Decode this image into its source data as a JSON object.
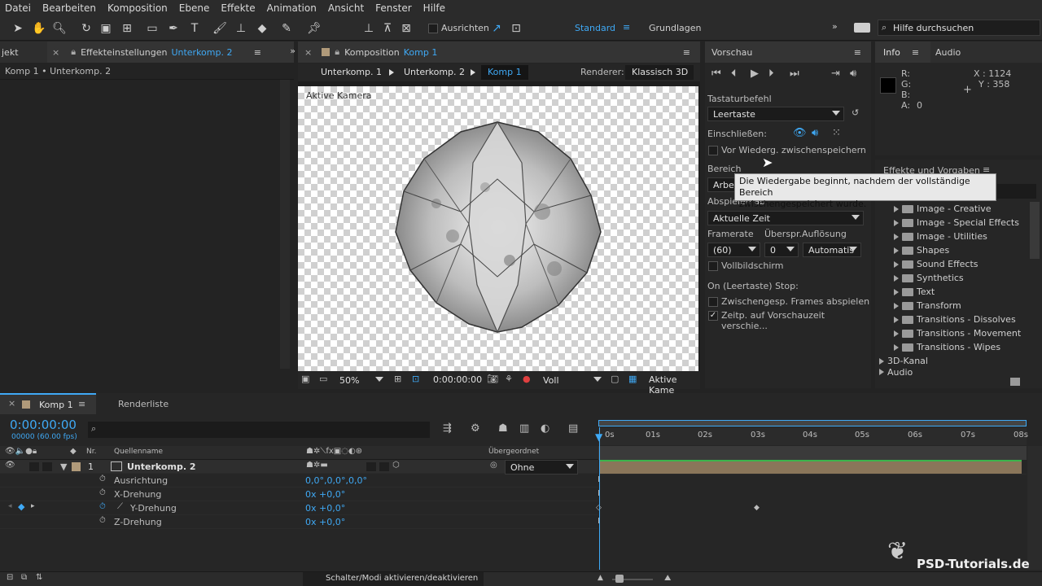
{
  "menu": [
    "Datei",
    "Bearbeiten",
    "Komposition",
    "Ebene",
    "Effekte",
    "Animation",
    "Ansicht",
    "Fenster",
    "Hilfe"
  ],
  "toolbar": {
    "align_label": "Ausrichten",
    "workspace_standard": "Standard",
    "workspace_basics": "Grundlagen",
    "help_placeholder": "Hilfe durchsuchen"
  },
  "project_panel": {
    "tab_label": "jekt"
  },
  "effect_controls": {
    "tab_label": "Effekteinstellungen",
    "tab_comp": "Unterkomp. 2",
    "breadcrumb": "Komp 1 • Unterkomp. 2"
  },
  "composition": {
    "tab_label": "Komposition",
    "tab_comp": "Komp 1",
    "crumbs": [
      "Unterkomp. 1",
      "Unterkomp. 2",
      "Komp 1"
    ],
    "renderer_label": "Renderer:",
    "renderer_value": "Klassisch 3D",
    "viewer_label": "Aktive Kamera",
    "zoom": "50%",
    "timecode": "0:00:00:00",
    "quality": "Voll",
    "view": "Aktive Kame"
  },
  "preview": {
    "title": "Vorschau",
    "shortcut_label": "Tastaturbefehl",
    "shortcut_value": "Leertaste",
    "include_label": "Einschließen:",
    "cache_label": "Vor Wiederg. zwischenspeichern",
    "range_label": "Bereich",
    "range_value": "Arbe",
    "tooltip_line1": "Die Wiedergabe beginnt, nachdem der vollständige Bereich",
    "tooltip_line2": "zwischengespeichert wurde.",
    "playfrom_label": "Abspielen ab",
    "playfrom_value": "Aktuelle Zeit",
    "framerate_label": "Framerate",
    "framerate_value": "(60)",
    "skip_label": "Überspr.",
    "skip_value": "0",
    "resolution_label": "Auflösung",
    "resolution_value": "Automatis",
    "fullscreen_label": "Vollbildschirm",
    "stop_label": "On (Leertaste) Stop:",
    "cached_frames_label": "Zwischengesp. Frames abspielen",
    "move_time_label": "Zeitp. auf Vorschauzeit verschie...",
    "move_time_checked": "✓"
  },
  "info": {
    "tab_info": "Info",
    "tab_audio": "Audio",
    "r": "R:",
    "g": "G:",
    "b": "B:",
    "a": "A:",
    "a_value": "0",
    "x": "X : 1124",
    "y": "Y : 358"
  },
  "effects": {
    "title": "Effekte und Vorgaben",
    "items": [
      "Image - Creative",
      "Image - Special Effects",
      "Image - Utilities",
      "Shapes",
      "Sound Effects",
      "Synthetics",
      "Text",
      "Transform",
      "Transitions - Dissolves",
      "Transitions - Movement",
      "Transitions - Wipes"
    ],
    "top_items": [
      "3D-Kanal",
      "Audio"
    ]
  },
  "timeline": {
    "tab_comp": "Komp 1",
    "tab_render": "Renderliste",
    "timecode": "0:00:00:00",
    "fps": "00000 (60.00 fps)",
    "col_nr": "Nr.",
    "col_source": "Quellenname",
    "col_parent": "Übergeordnet",
    "layer_number": "1",
    "layer_name": "Unterkomp. 2",
    "parent_value": "Ohne",
    "props": [
      {
        "name": "Ausrichtung",
        "value": "0,0°,0,0°,0,0°"
      },
      {
        "name": "X-Drehung",
        "value": "0x +0,0°"
      },
      {
        "name": "Y-Drehung",
        "value": "0x +0,0°"
      },
      {
        "name": "Z-Drehung",
        "value": "0x +0,0°"
      }
    ],
    "ticks": [
      "0s",
      "01s",
      "02s",
      "03s",
      "04s",
      "05s",
      "06s",
      "07s",
      "08s"
    ],
    "toggle_label": "Schalter/Modi aktivieren/deaktivieren"
  },
  "watermark": "PSD-Tutorials.de"
}
